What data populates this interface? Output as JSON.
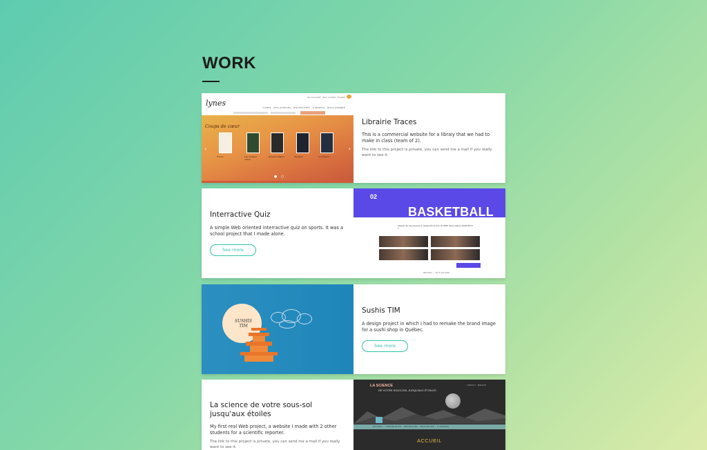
{
  "section": {
    "title": "WORK"
  },
  "projects": [
    {
      "title": "Librairie Traces",
      "description": "This is a commercial website for a libraiy that we had to make in class (team of 2).",
      "note": "The link to this project is private, you can send me a mail if you really want to see it.",
      "thumbnail": {
        "logo": "lynes",
        "toplinks": "Se connecter · Mon compte · English",
        "nav": "LIVRES · NOS AUTEURS · NOUVEAUTÉS · À PROPOS · NOUS JOINDRE",
        "hero_title": "Coups de cœur",
        "search_button": "RECHERCHER",
        "book_captions": [
          "Traces",
          "Les quelque chose",
          "Jacques Séguin",
          "Abysses",
          "Le Chapon"
        ]
      }
    },
    {
      "title": "Interractive Quiz",
      "description": "A simple Web oriented interractive quiz on sports. It was a school project that I made alone.",
      "button": "See more",
      "thumbnail": {
        "number": "02",
        "heading": "BASKETBALL",
        "question": "Lequel de ces joueurs a remporté le prix du MVP de la saison 2016-2017 ?",
        "submit": "SOUMETTRE",
        "footer": "Attribution — Tim P. Quiz 2016"
      }
    },
    {
      "title": "Sushis TIM",
      "description": "A design project in which I had to remake the brand image for a sushi shop in Québec.",
      "button": "See more",
      "thumbnail": {
        "label_top": "SUSHIS",
        "label_bottom": "TIM"
      }
    },
    {
      "title": "La science de votre sous-sol jusqu'aux étoiles",
      "description": "My first real Web project, a website I made with 2 other students for a scientific reporter.",
      "note": "The link to this project is private, you can send me a mail if you really want to see it.",
      "thumbnail": {
        "brand": "LA SCIENCE",
        "subtitle": "DE VOTRE SOUS-SOL JUSQU'AUX ÉTOILES",
        "links": "CONTACT · ENGLISH",
        "menu": "ACCUEIL · CHRONIQUES · ENTREVUES · NOUVELLES · À PROPOS",
        "accueil": "ACCUEIL"
      }
    }
  ],
  "colors": {
    "accent": "#2ec4a8",
    "quiz_purple": "#5a49e6",
    "sushi_blue": "#2187bb",
    "science_dark": "#2b2b2b"
  }
}
